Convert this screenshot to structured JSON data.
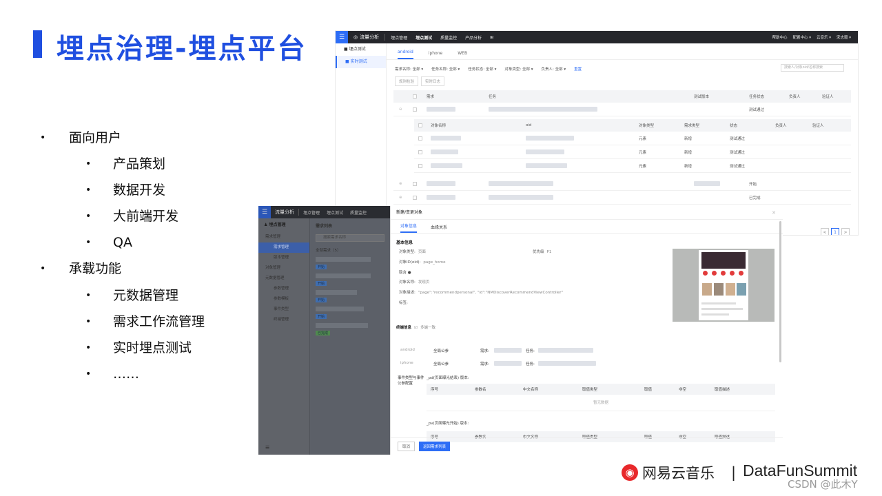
{
  "slide": {
    "title": "埋点治理-埋点平台",
    "bullets": [
      {
        "level": 1,
        "text": "面向用户"
      },
      {
        "level": 2,
        "text": "产品策划"
      },
      {
        "level": 2,
        "text": "数据开发"
      },
      {
        "level": 2,
        "text": "大前端开发"
      },
      {
        "level": 2,
        "text": "QA"
      },
      {
        "level": 1,
        "text": "承载功能"
      },
      {
        "level": 2,
        "text": "元数据管理"
      },
      {
        "level": 2,
        "text": "需求工作流管理"
      },
      {
        "level": 2,
        "text": "实时埋点测试"
      },
      {
        "level": 2,
        "text": "……"
      }
    ],
    "bullet_char": "•"
  },
  "shotA": {
    "brand": "流量分析",
    "nav": [
      "埋点管理",
      "埋点测试",
      "质量监控",
      "产品分析"
    ],
    "nav_right": [
      "帮助中心",
      "配置中心 ▾",
      "云音乐 ▾",
      "宋志毅 ▾"
    ],
    "sidebar": [
      "埋点测试",
      "实时测试"
    ],
    "tabs": [
      "android",
      "iphone",
      "WEB"
    ],
    "filters": [
      "需求名称: 全部 ▾",
      "任务名称: 全部 ▾",
      "任务状态: 全部 ▾",
      "对象类型: 全部 ▾",
      "负责人: 全部 ▾"
    ],
    "reset": "重置",
    "search_placeholder": "搜索人/对象oid/名称搜索",
    "buttons": [
      "规则检验",
      "实时日志"
    ],
    "table_headers": {
      "req": "需求",
      "task": "任务",
      "version": "测试版本",
      "status": "任务状态",
      "owner": "负责人",
      "verifier": "验证人"
    },
    "rows": [
      {
        "status": "测试通过"
      },
      {
        "status": "开始"
      },
      {
        "status": "已完成"
      }
    ],
    "sub_headers": {
      "name": "对象名称",
      "oid": "oid",
      "type": "对象类型",
      "req_type": "需求类型",
      "state": "状态",
      "owner": "负责人",
      "verifier": "验证人"
    },
    "sub_rows": [
      {
        "type": "元素",
        "req_type": "新增",
        "state": "测试通过"
      },
      {
        "type": "元素",
        "req_type": "新增",
        "state": "测试通过"
      },
      {
        "type": "元素",
        "req_type": "新增",
        "state": "测试通过"
      }
    ],
    "pager": [
      "<",
      "1",
      ">"
    ]
  },
  "shotB": {
    "brand": "流量分析",
    "nav": [
      "埋点管理",
      "埋点测试",
      "质量监控"
    ],
    "sidebar_head": "埋点管理",
    "sidebar": [
      {
        "label": "需求管理",
        "sub": false,
        "active": false
      },
      {
        "label": "需求管理",
        "sub": true,
        "active": true
      },
      {
        "label": "版本管理",
        "sub": true,
        "active": false
      },
      {
        "label": "对象管理",
        "sub": false,
        "active": false
      },
      {
        "label": "元数据管理",
        "sub": false,
        "active": false
      },
      {
        "label": "参数管理",
        "sub": true,
        "active": false
      },
      {
        "label": "参数模板",
        "sub": true,
        "active": false
      },
      {
        "label": "事件类型",
        "sub": true,
        "active": false
      },
      {
        "label": "终端管理",
        "sub": true,
        "active": false
      }
    ],
    "list_title": "需求列表",
    "search_placeholder": "搜索需求名称",
    "count": "全部需求（5）",
    "tags": [
      "开始",
      "开始",
      "开始",
      "开始",
      "已完成"
    ]
  },
  "dialog": {
    "title": "新建/变更对象",
    "tabs": [
      "对象信息",
      "血缘关系"
    ],
    "basic_title": "基本信息",
    "fields": {
      "obj_type_k": "对象类型:",
      "obj_type_v": "页面",
      "priority_k": "优先级",
      "priority_v": "P1",
      "oid_k": "对象ID(oid):",
      "oid_v": "page_home",
      "hide_k": "隐含",
      "name_k": "对象名称:",
      "name_v": "发现页",
      "desc_k": "对象描述:",
      "desc_v": "\"page\":\"recommendpersonal\", \"id\":\"NMDiscoverRecommendViewController\"",
      "tag_k": "标签:"
    },
    "terminal_title": "终端信息",
    "multi_end": "多端一致",
    "terminals": [
      {
        "name": "android",
        "public": "全局公参",
        "req": "需求:",
        "task": "任务:"
      },
      {
        "name": "iphone",
        "public": "全局公参",
        "req": "需求:",
        "task": "任务:"
      }
    ],
    "event_title": "事件类型与事件公参配置",
    "event1": "_pd(页面曝光结束)   版本:",
    "event2": "_pv(页面曝光开始)   版本:",
    "col_headers": [
      "序号",
      "参数名",
      "中文名称",
      "取值类型",
      "取值",
      "非空",
      "取值描述"
    ],
    "empty": "暂无数据",
    "cancel": "取消",
    "submit": "返回需求列表"
  },
  "footer": {
    "brand_cn": "网易云音乐",
    "sep": "|",
    "brand_en": "DataFunSummit",
    "watermark": "CSDN @此木Y"
  }
}
